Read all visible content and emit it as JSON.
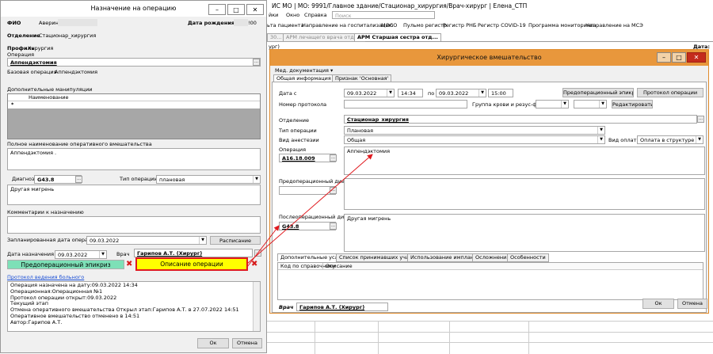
{
  "bg": {
    "title": "ИС МО | МО: 9991/Главное здание/Стационар_хирургия/Врач-хирург | Елена_СТП",
    "menu": [
      "йки",
      "Окно",
      "Справка"
    ],
    "search_placeholder": "Поиск",
    "toolbar": [
      "ьта пациента",
      "Направление на госпитализацию",
      "МОСО",
      "Пульмо регистр",
      "Регистр РНБ",
      "Регистр COVID-19",
      "Программа мониторинга",
      "Направление на МСЭ"
    ],
    "tabs": [
      "30...",
      "АРМ лечащего врача отде...",
      "АРМ Старшая сестра отд..."
    ],
    "left_stub": "ург)",
    "right_stub": "Дата:"
  },
  "left": {
    "title": "Назначение на операцию",
    "fio_label": "ФИО",
    "fio_value": "Аверин",
    "dob_label": "Дата рождения",
    "dob_value": "!00",
    "dept_label": "Отделение",
    "dept_value": "Стационар_хирургия",
    "profile_label": "Профиль",
    "profile_value": "Хирургия",
    "op_label": "Операция",
    "op_value": "Аппендэктомия",
    "base_op_label": "Базовая операция",
    "base_op_value": "Аппендэктомия",
    "extra_label": "Дополнительные манипуляции",
    "grid_header": "Наименование",
    "grid_star": "*",
    "full_name_label": "Полное наименование оперативного вмешательства",
    "full_name_value": "Аппендэктомия .",
    "diag_label": "Диагноз",
    "diag_code": "G43.8",
    "op_type_label": "Тип операции",
    "op_type_value": "плановая",
    "diag_text": "Другая мигрень",
    "comment_label": "Комментарии к назначению",
    "planned_label": "Запланированная дата операции",
    "planned_value": "09.03.2022",
    "schedule_btn": "Расписание",
    "assign_label": "Дата назначения",
    "assign_value": "09.03.2022",
    "doctor_label": "Врач",
    "doctor_value": "Гарипов А.Т. (Хирург)",
    "epicrisis_btn": "Предоперационный эпикриз",
    "desc_btn": "Описание операции",
    "protocol_link": "Протокол ведения больного",
    "log": [
      "Операция назначена на дату:09.03.2022 14:34",
      "Операционная:Операционная №1",
      "Протокол операции открыт:09.03.2022",
      "Текущий этап",
      "Отмена оперативного вмешательства Открыл этап:Гарипов А.Т. в 27.07.2022 14:51",
      "Оперативное вмешательство отменено в 14:51",
      "Автор:Гарипов А.Т."
    ],
    "ok": "Ок",
    "cancel": "Отмена"
  },
  "right": {
    "title": "Хирургическое вмешательство",
    "med_docs": "Мед. документация",
    "tab1": "Общая информация",
    "tab2": "Признак 'Основная'",
    "date_from_label": "Дата с",
    "date_from": "09.03.2022",
    "time_from": "14:34",
    "to_label": "по",
    "date_to": "09.03.2022",
    "time_to": "15:00",
    "preop_epi_btn": "Предоперационный эпикриз",
    "protocol_btn": "Протокол операции",
    "protocol_no_label": "Номер протокола",
    "blood_label": "Группа крови и резус-фактор",
    "edit_btn": "Редактировать",
    "dept_label": "Отделение",
    "dept_value": "Стационар_хирургия",
    "op_type_label": "Тип операции",
    "op_type_value": "Плановая",
    "anesth_label": "Вид анестезии",
    "anesth_value": "Общая",
    "pay_label": "Вид оплаты",
    "pay_value": "Оплата в структуре тарифа",
    "op_label": "Операция",
    "op_code": "A16.18.009",
    "op_text": "Аппендэктомия",
    "preop_diag_label": "Предоперационный диагноз",
    "postop_diag_label": "Послеоперационный диагноз",
    "postop_code": "G43.8",
    "postop_text": "Другая мигрень",
    "bottom_tabs": [
      "Дополнительные услуги",
      "Список принимавших участие",
      "Использование имплантов",
      "Осложнения",
      "Особенности"
    ],
    "grid_cols": [
      "Код по справочнику",
      "Описание"
    ],
    "doctor_label": "Врач",
    "doctor_value": "Гарипов А.Т. (Хирург)",
    "ok": "Ок",
    "cancel": "Отмена"
  },
  "colors": {
    "accent_orange": "#e8973c",
    "highlight_green": "#7de0b7",
    "highlight_yellow": "#ffff00",
    "arrow_red": "#e0191e"
  }
}
